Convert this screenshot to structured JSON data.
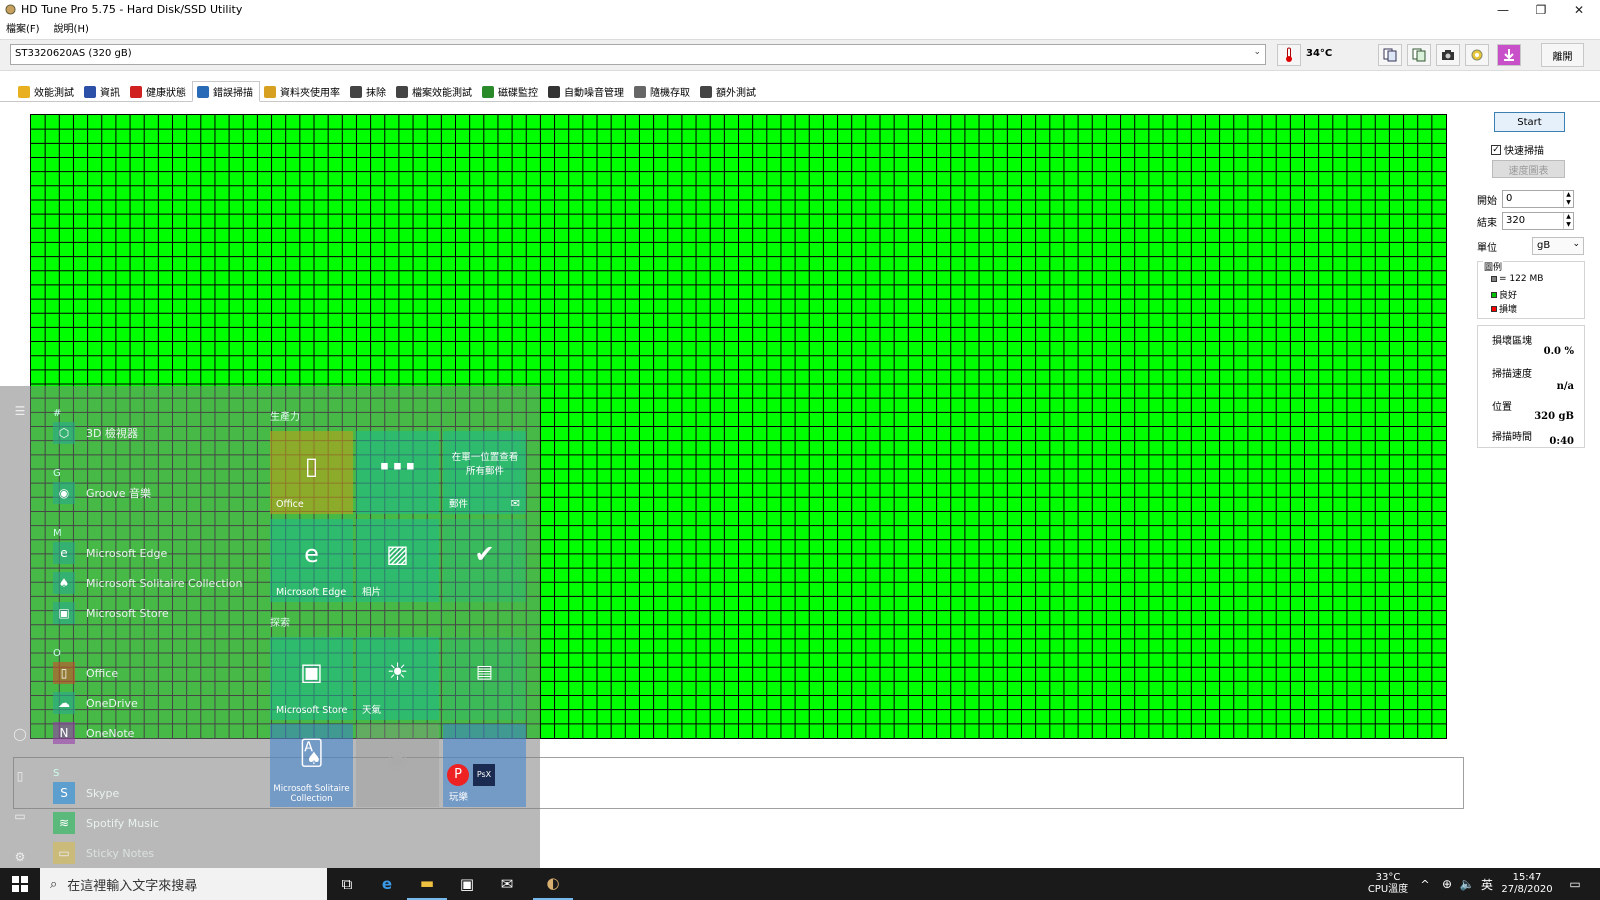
{
  "window": {
    "title": "HD Tune Pro 5.75 - Hard Disk/SSD Utility",
    "minimize": "—",
    "restore": "❐",
    "close": "✕"
  },
  "menu": [
    "檔案(F)",
    "說明(H)"
  ],
  "toolbar": {
    "drive": "ST3320620AS (320 gB)",
    "temperature": "34°C",
    "exit_label": "離開"
  },
  "tabs": [
    {
      "label": "效能測試"
    },
    {
      "label": "資訊"
    },
    {
      "label": "健康狀態"
    },
    {
      "label": "錯誤掃描",
      "active": true
    },
    {
      "label": "資料夾使用率"
    },
    {
      "label": "抹除"
    },
    {
      "label": "檔案效能測試"
    },
    {
      "label": "磁碟監控"
    },
    {
      "label": "自動噪音管理"
    },
    {
      "label": "隨機存取"
    },
    {
      "label": "額外測試"
    }
  ],
  "scan": {
    "start_label": "Start",
    "quick_scan_label": "快速掃描",
    "quick_scan_checked": true,
    "speed_chart_label": "速度圖表",
    "start_field_label": "開始",
    "start_value": "0",
    "end_field_label": "結束",
    "end_value": "320",
    "unit_label": "單位",
    "unit_value": "gB",
    "legend_title": "圖例",
    "legend": [
      {
        "label": "= 122 MB",
        "color": "#808080"
      },
      {
        "label": "良好",
        "color": "#00c000"
      },
      {
        "label": "損壞",
        "color": "#ff0000"
      }
    ],
    "stats": {
      "damaged_label": "損壞區塊",
      "damaged_value": "0.0 %",
      "speed_label": "掃描速度",
      "speed_value": "n/a",
      "position_label": "位置",
      "position_value": "320 gB",
      "time_label": "掃描時間",
      "time_value": "0:40"
    },
    "block_status": "good",
    "grid_color": "#00ff00"
  },
  "start_menu": {
    "letters": [
      "#",
      "G",
      "M",
      "O",
      "S"
    ],
    "apps": [
      {
        "label": "3D 檢視器",
        "icon": "cube-icon"
      },
      {
        "label": "Groove 音樂",
        "icon": "music-icon"
      },
      {
        "label": "Microsoft Edge",
        "icon": "edge-icon"
      },
      {
        "label": "Microsoft Solitaire Collection",
        "icon": "cards-icon"
      },
      {
        "label": "Microsoft Store",
        "icon": "store-icon"
      },
      {
        "label": "Office",
        "icon": "office-icon"
      },
      {
        "label": "OneDrive",
        "icon": "cloud-icon"
      },
      {
        "label": "OneNote",
        "icon": "onenote-icon"
      },
      {
        "label": "Skype",
        "icon": "skype-icon"
      },
      {
        "label": "Spotify Music",
        "icon": "spotify-icon"
      },
      {
        "label": "Sticky Notes",
        "icon": "note-icon"
      }
    ],
    "groups": [
      "生產力",
      "探索"
    ],
    "tiles": {
      "office": "Office",
      "mail_text": "在單一位置查看所有郵件",
      "mail": "郵件",
      "edge": "Microsoft Edge",
      "photos": "相片",
      "store": "Microsoft Store",
      "weather": "天氣",
      "solitaire": "Microsoft Solitaire Collection",
      "play": "玩樂"
    }
  },
  "taskbar": {
    "search_placeholder": "在這裡輸入文字來搜尋",
    "cpu_temp": "33°C",
    "cpu_label": "CPU溫度",
    "ime": "英",
    "time": "15:47",
    "date": "27/8/2020"
  }
}
